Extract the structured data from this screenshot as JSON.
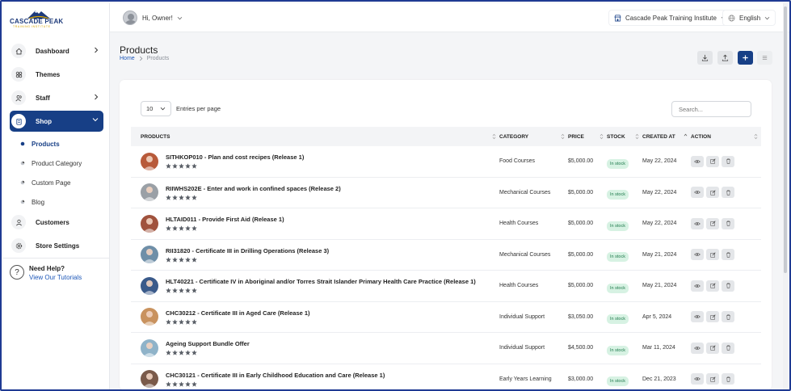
{
  "brand": {
    "name": "CASCADE PEAK",
    "tagline": "TRAINING INSTITUTE"
  },
  "colors": {
    "primary": "#173f86",
    "accent_gold": "#d9a400",
    "stock_bg": "#d7f2e3",
    "stock_text": "#1f7a4c"
  },
  "topbar": {
    "greeting": "Hi, Owner!",
    "institute": "Cascade Peak Training Institute",
    "language": "English"
  },
  "sidebar": {
    "items": [
      {
        "label": "Dashboard",
        "icon": "home-icon",
        "has_chevron": true
      },
      {
        "label": "Themes",
        "icon": "grid-icon",
        "has_chevron": false
      },
      {
        "label": "Staff",
        "icon": "users-icon",
        "has_chevron": true
      },
      {
        "label": "Shop",
        "icon": "shop-icon",
        "has_chevron": true,
        "active": true
      }
    ],
    "sub_items": [
      {
        "label": "Products",
        "active": true
      },
      {
        "label": "Product Category"
      },
      {
        "label": "Custom Page"
      },
      {
        "label": "Blog"
      }
    ],
    "bottom_items": [
      {
        "label": "Customers",
        "icon": "user-icon"
      },
      {
        "label": "Store Settings",
        "icon": "gear-icon"
      }
    ],
    "help": {
      "title": "Need Help?",
      "link": "View Our Tutorials"
    }
  },
  "page": {
    "title": "Products",
    "breadcrumb": {
      "home": "Home",
      "current": "Products"
    }
  },
  "table_controls": {
    "entries_value": "10",
    "entries_label": "Entries per page",
    "search_placeholder": "Search..."
  },
  "table": {
    "headers": {
      "products": "PRODUCTS",
      "category": "CATEGORY",
      "price": "PRICE",
      "stock": "STOCK",
      "created": "CREATED AT",
      "action": "ACTION"
    },
    "rows": [
      {
        "name": "SITHKOP010 - Plan and cost recipes (Release 1)",
        "category": "Food Courses",
        "price": "$5,000.00",
        "stock": "In stock",
        "created": "May 22, 2024",
        "rating": 5,
        "thumb": "#b85a3a"
      },
      {
        "name": "RIIWHS202E - Enter and work in confined spaces (Release 2)",
        "category": "Mechanical Courses",
        "price": "$5,000.00",
        "stock": "In stock",
        "created": "May 22, 2024",
        "rating": 5,
        "thumb": "#9aa0a6"
      },
      {
        "name": "HLTAID011 - Provide First Aid (Release 1)",
        "category": "Health Courses",
        "price": "$5,000.00",
        "stock": "In stock",
        "created": "May 22, 2024",
        "rating": 5,
        "thumb": "#a0523d"
      },
      {
        "name": "RII31820 - Certificate III in Drilling Operations (Release 3)",
        "category": "Mechanical Courses",
        "price": "$5,000.00",
        "stock": "In stock",
        "created": "May 21, 2024",
        "rating": 5,
        "thumb": "#6f8fa8"
      },
      {
        "name": "HLT40221 - Certificate IV in Aboriginal and/or Torres Strait Islander Primary Health Care Practice (Release 1)",
        "category": "Health Courses",
        "price": "$5,000.00",
        "stock": "In stock",
        "created": "May 21, 2024",
        "rating": 5,
        "thumb": "#3a5a8a"
      },
      {
        "name": "CHC30212 - Certificate III in Aged Care (Release 1)",
        "category": "Individual Support",
        "price": "$3,050.00",
        "stock": "In stock",
        "created": "Apr 5, 2024",
        "rating": 5,
        "thumb": "#c9925e"
      },
      {
        "name": "Ageing Support Bundle Offer",
        "category": "Individual Support",
        "price": "$4,500.00",
        "stock": "In stock",
        "created": "Mar 11, 2024",
        "rating": 5,
        "thumb": "#8fb3c9"
      },
      {
        "name": "CHC30121 - Certificate III in Early Childhood Education and Care (Release 1)",
        "category": "Early Years Learning",
        "price": "$3,000.00",
        "stock": "In stock",
        "created": "Dec 21, 2023",
        "rating": 5,
        "thumb": "#7a5a4a"
      }
    ]
  }
}
